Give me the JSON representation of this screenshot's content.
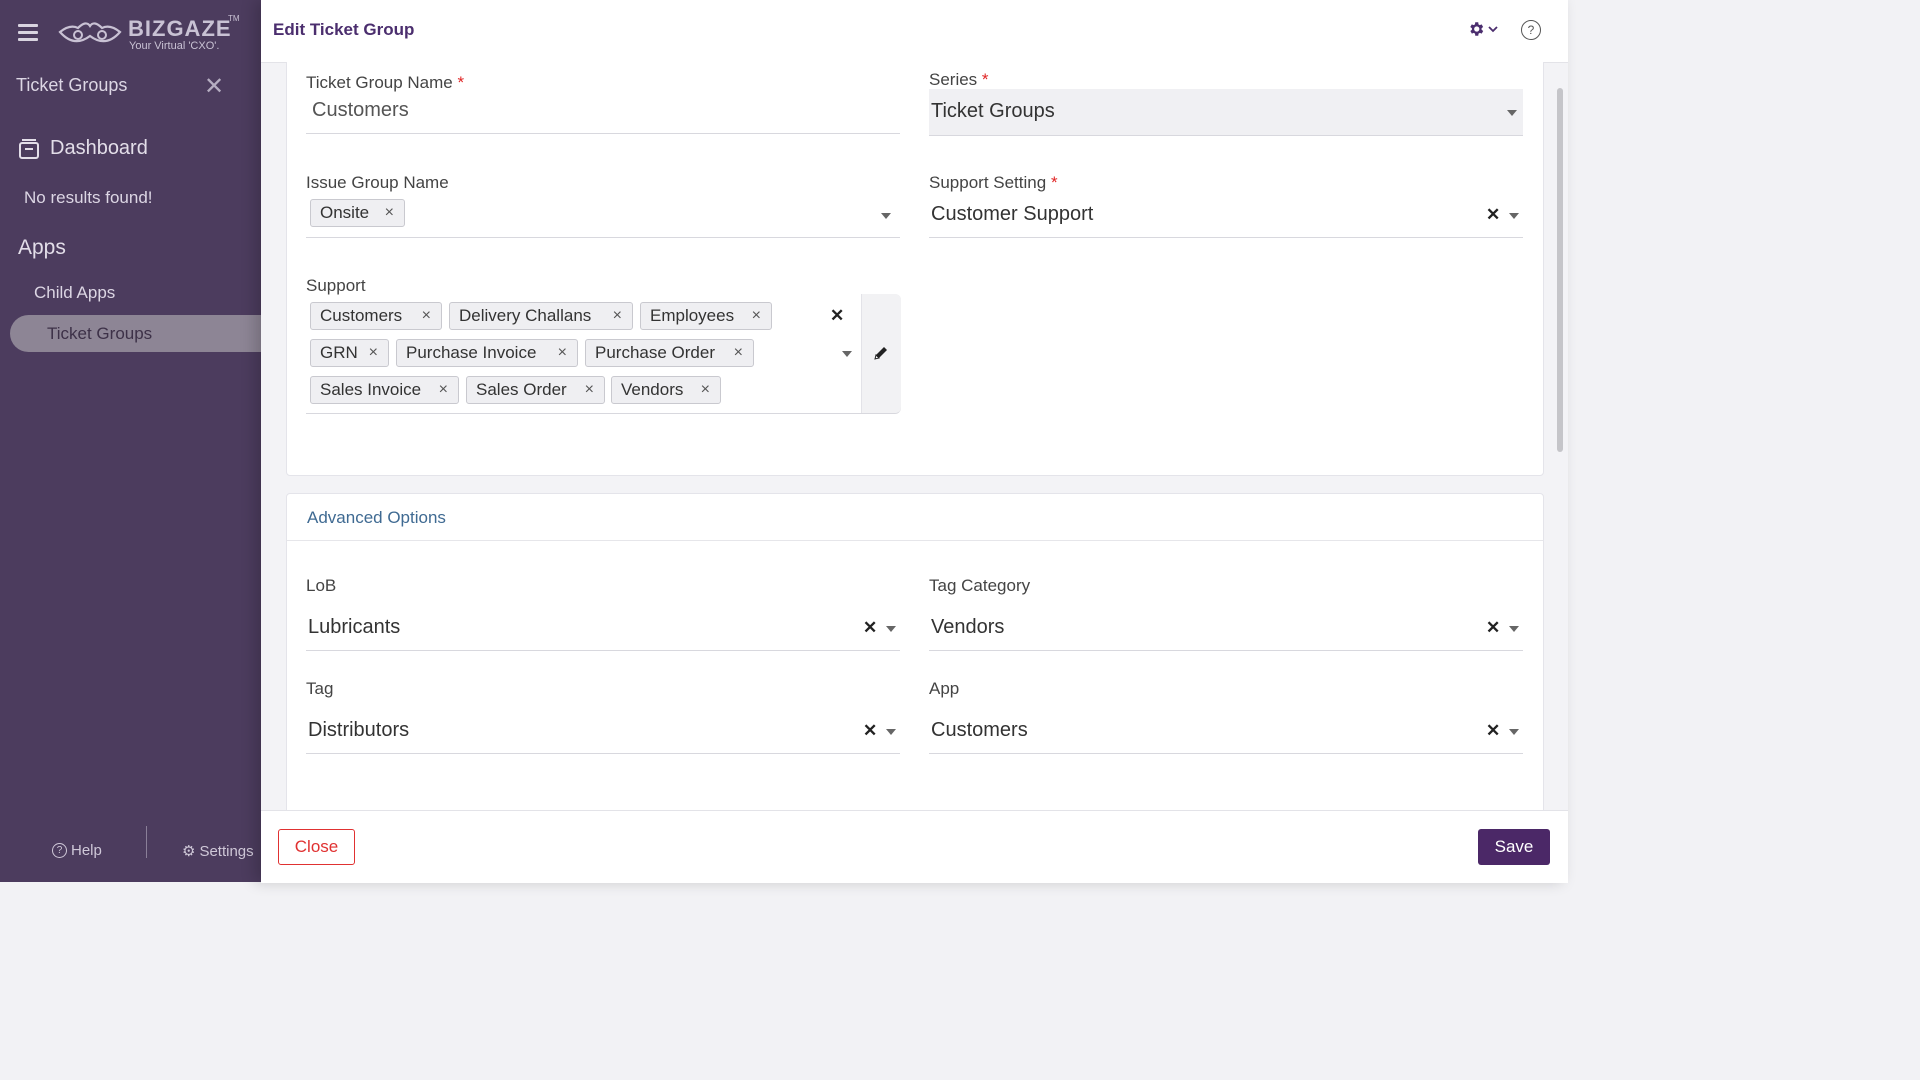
{
  "sidebar": {
    "brand": "BIZGAZE",
    "brand_tm": "TM",
    "brand_tagline": "Your Virtual 'CXO'.",
    "panel_title": "Ticket Groups",
    "dashboard_label": "Dashboard",
    "no_results": "No results found!",
    "apps_heading": "Apps",
    "child_apps": "Child Apps",
    "active_item": "Ticket Groups",
    "help": "Help",
    "settings": "Settings"
  },
  "header": {
    "title": "Edit Ticket Group"
  },
  "form": {
    "ticket_group_name": {
      "label": "Ticket Group Name",
      "value": "Customers"
    },
    "series": {
      "label": "Series",
      "value": "Ticket Groups"
    },
    "issue_group_name": {
      "label": "Issue Group Name",
      "chips": [
        "Onsite"
      ]
    },
    "support_setting": {
      "label": "Support Setting",
      "value": "Customer Support"
    },
    "support": {
      "label": "Support",
      "chips": [
        "Customers",
        "Delivery Challans",
        "Employees",
        "GRN",
        "Purchase Invoice",
        "Purchase Order",
        "Sales Invoice",
        "Sales Order",
        "Vendors"
      ]
    },
    "required_mark": "*"
  },
  "advanced": {
    "title": "Advanced Options",
    "lob": {
      "label": "LoB",
      "value": "Lubricants"
    },
    "tag_category": {
      "label": "Tag Category",
      "value": "Vendors"
    },
    "tag": {
      "label": "Tag",
      "value": "Distributors"
    },
    "app": {
      "label": "App",
      "value": "Customers"
    }
  },
  "footer": {
    "close_label": "Close",
    "save_label": "Save"
  },
  "icons": {
    "remove": "×",
    "clear": "✕",
    "pencil": "pencil-icon",
    "gear": "gear-icon",
    "help": "?"
  },
  "colors": {
    "sidebar_bg": "#4c3c5e",
    "brand_purple": "#4b2e6e",
    "save_bg": "#4b2867",
    "danger": "#e03131",
    "section_title": "#3f6a92"
  }
}
